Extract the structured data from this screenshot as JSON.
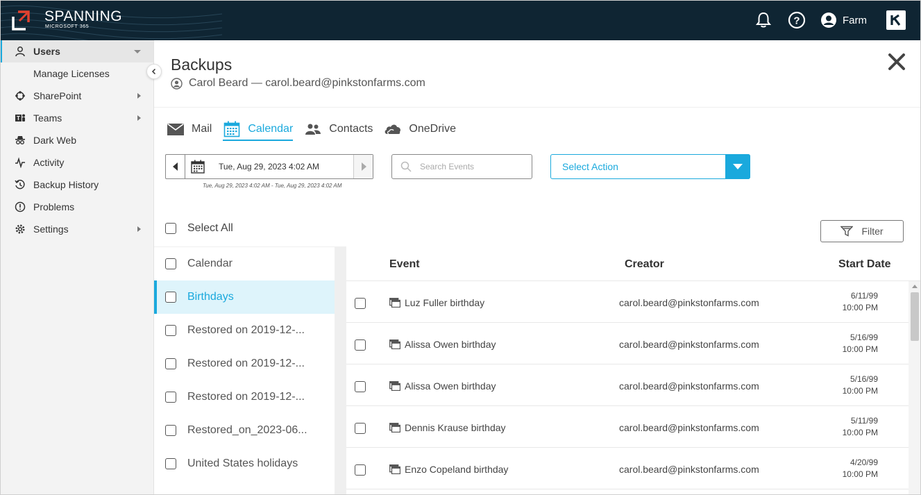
{
  "header": {
    "brand": "SPANNING",
    "brand_sub": "MICROSOFT 365",
    "user_name": "Farm",
    "icons": [
      "bell-icon",
      "help-icon",
      "user-avatar-icon",
      "k-app-icon"
    ]
  },
  "sidebar": {
    "items": [
      {
        "label": "Users",
        "icon": "user-icon",
        "active": true
      },
      {
        "label": "Manage Licenses",
        "sub": true
      },
      {
        "label": "SharePoint",
        "icon": "sharepoint-icon"
      },
      {
        "label": "Teams",
        "icon": "teams-icon"
      },
      {
        "label": "Dark Web",
        "icon": "spy-icon"
      },
      {
        "label": "Activity",
        "icon": "activity-icon"
      },
      {
        "label": "Backup History",
        "icon": "history-icon"
      },
      {
        "label": "Problems",
        "icon": "alert-icon"
      },
      {
        "label": "Settings",
        "icon": "gear-icon"
      }
    ]
  },
  "page": {
    "title": "Backups",
    "user_line": "Carol Beard — carol.beard@pinkstonfarms.com"
  },
  "tabs": [
    {
      "label": "Mail",
      "icon": "mail-icon"
    },
    {
      "label": "Calendar",
      "icon": "calendar-icon",
      "active": true
    },
    {
      "label": "Contacts",
      "icon": "contacts-icon"
    },
    {
      "label": "OneDrive",
      "icon": "cloud-icon"
    }
  ],
  "toolbar": {
    "date_value": "Tue, Aug 29, 2023 4:02 AM",
    "date_range": "Tue, Aug 29, 2023 4:02 AM - Tue, Aug 29, 2023 4:02 AM",
    "search_placeholder": "Search Events",
    "select_action": "Select Action",
    "select_all": "Select All",
    "filter": "Filter"
  },
  "calendars": [
    {
      "label": "Calendar"
    },
    {
      "label": "Birthdays",
      "active": true
    },
    {
      "label": "Restored on 2019-12-..."
    },
    {
      "label": "Restored on 2019-12-..."
    },
    {
      "label": "Restored on 2019-12-..."
    },
    {
      "label": "Restored_on_2023-06..."
    },
    {
      "label": "United States holidays"
    }
  ],
  "events": {
    "columns": {
      "event": "Event",
      "creator": "Creator",
      "start": "Start Date"
    },
    "rows": [
      {
        "name": "Luz Fuller birthday",
        "creator": "carol.beard@pinkstonfarms.com",
        "date": "6/11/99",
        "time": "10:00 PM"
      },
      {
        "name": "Alissa Owen birthday",
        "creator": "carol.beard@pinkstonfarms.com",
        "date": "5/16/99",
        "time": "10:00 PM"
      },
      {
        "name": "Alissa Owen birthday",
        "creator": "carol.beard@pinkstonfarms.com",
        "date": "5/16/99",
        "time": "10:00 PM"
      },
      {
        "name": "Dennis Krause birthday",
        "creator": "carol.beard@pinkstonfarms.com",
        "date": "5/11/99",
        "time": "10:00 PM"
      },
      {
        "name": "Enzo Copeland birthday",
        "creator": "carol.beard@pinkstonfarms.com",
        "date": "4/20/99",
        "time": "10:00 PM"
      }
    ]
  },
  "colors": {
    "topbar": "#0f2533",
    "accent": "#1aa9dd",
    "sidebar_bg": "#f3f3f3",
    "active_row": "#def4fb"
  }
}
